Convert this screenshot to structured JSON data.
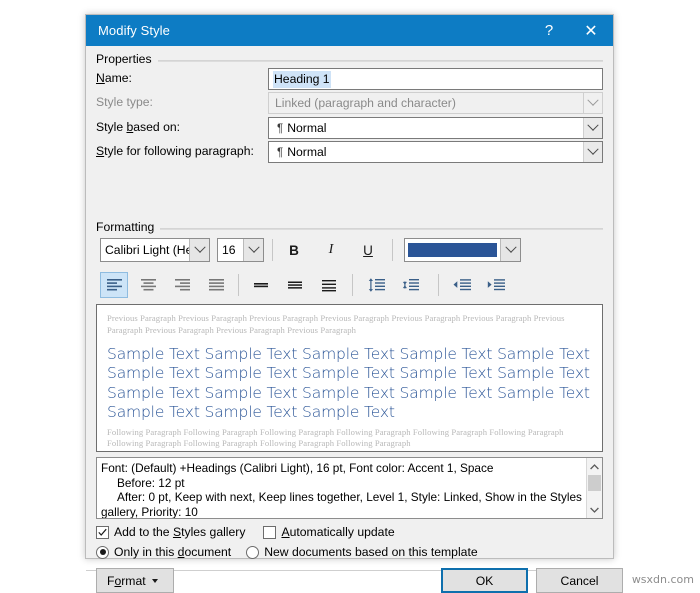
{
  "window": {
    "title": "Modify Style",
    "help_icon": "?",
    "close_icon": "✕",
    "titlebar_color": "#0d7cc4"
  },
  "properties": {
    "group_label": "Properties",
    "name": {
      "label": "Name:",
      "label_accel": "N",
      "value": "Heading 1",
      "selected": true
    },
    "style_type": {
      "label": "Style type:",
      "value": "Linked (paragraph and character)",
      "disabled": true
    },
    "style_based_on": {
      "label": "Style based on:",
      "label_accel": "b",
      "value": "Normal",
      "glyph": "¶"
    },
    "style_following": {
      "label": "Style for following paragraph:",
      "label_accel": "S",
      "value": "Normal",
      "glyph": "¶"
    }
  },
  "formatting": {
    "group_label": "Formatting",
    "font_family": "Calibri Light (Head",
    "font_size": "16",
    "bold_label": "B",
    "italic_label": "I",
    "underline_label": "U",
    "font_color": "#2b5597",
    "alignment": {
      "selected": "left",
      "options": [
        "align-left",
        "align-center",
        "align-right",
        "align-justify"
      ]
    },
    "line_spacing": [
      "line-spacing-single",
      "line-spacing-1-5",
      "line-spacing-double"
    ],
    "paragraph_spacing": [
      "increase-paragraph-spacing",
      "decrease-paragraph-spacing"
    ],
    "indent": [
      "decrease-indent",
      "increase-indent"
    ]
  },
  "preview": {
    "previous_paragraph": "Previous Paragraph Previous Paragraph Previous Paragraph Previous Paragraph Previous Paragraph Previous Paragraph Previous Paragraph Previous Paragraph Previous Paragraph Previous Paragraph",
    "sample_text": "Sample Text Sample Text Sample Text Sample Text Sample Text Sample Text Sample Text Sample Text Sample Text Sample Text Sample Text Sample Text Sample Text Sample Text Sample Text Sample Text Sample Text Sample Text",
    "following_paragraph": "Following Paragraph Following Paragraph Following Paragraph Following Paragraph Following Paragraph Following Paragraph Following Paragraph Following Paragraph Following Paragraph Following Paragraph"
  },
  "description": {
    "line1": "Font: (Default) +Headings (Calibri Light), 16 pt, Font color: Accent 1, Space",
    "line2": "Before:  12 pt",
    "line3": "After:  0 pt, Keep with next, Keep lines together, Level 1, Style: Linked, Show in the Styles",
    "line4": "gallery, Priority: 10",
    "scroll_up_icon": "⌃",
    "scroll_down_icon": "⌄"
  },
  "options": {
    "add_to_gallery": {
      "label": "Add to the Styles gallery",
      "label_accel": "S",
      "checked": true
    },
    "automatically_update": {
      "label": "Automatically update",
      "label_accel": "A",
      "checked": false
    },
    "only_this_document": {
      "label": "Only in this document",
      "label_accel": "d",
      "selected": true
    },
    "new_documents_template": {
      "label": "New documents based on this template",
      "selected": false
    }
  },
  "buttons": {
    "format": "Format",
    "format_accel": "o",
    "ok": "OK",
    "cancel": "Cancel"
  },
  "watermark": "wsxdn.com"
}
